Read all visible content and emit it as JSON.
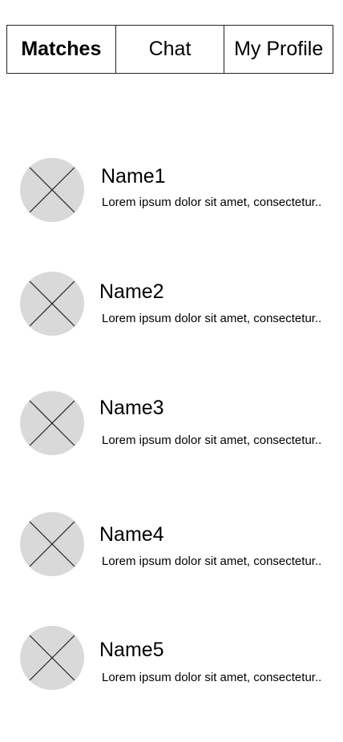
{
  "tabs": [
    {
      "label": "Matches",
      "active": true
    },
    {
      "label": "Chat",
      "active": false
    },
    {
      "label": "My Profile",
      "active": false
    }
  ],
  "matches": [
    {
      "name": "Name1",
      "preview": "Lorem ipsum dolor sit amet, consectetur.."
    },
    {
      "name": "Name2",
      "preview": "Lorem ipsum dolor sit amet, consectetur.."
    },
    {
      "name": "Name3",
      "preview": "Lorem ipsum dolor sit amet, consectetur.."
    },
    {
      "name": "Name4",
      "preview": "Lorem ipsum dolor sit amet, consectetur.."
    },
    {
      "name": "Name5",
      "preview": "Lorem ipsum dolor sit amet, consectetur.."
    }
  ],
  "colors": {
    "avatar_placeholder": "#d9d9d9",
    "border": "#222222",
    "text": "#000000"
  },
  "icons": {
    "avatar": "image-placeholder-icon"
  }
}
